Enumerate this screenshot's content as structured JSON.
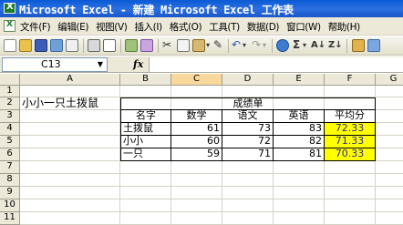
{
  "window": {
    "title": "Microsoft Excel - 新建 Microsoft Excel 工作表"
  },
  "menu": [
    "文件(F)",
    "编辑(E)",
    "视图(V)",
    "插入(I)",
    "格式(O)",
    "工具(T)",
    "数据(D)",
    "窗口(W)",
    "帮助(H)"
  ],
  "formula_bar": {
    "name_box": "C13",
    "fx_label": "fx",
    "value": ""
  },
  "columns": [
    "A",
    "B",
    "C",
    "D",
    "E",
    "F",
    "G"
  ],
  "rows": [
    "1",
    "2",
    "3",
    "4",
    "5",
    "6",
    "7",
    "8",
    "9",
    "10",
    "11"
  ],
  "sheet": {
    "a2": "小小一只土拨鼠",
    "table_title": "成绩单",
    "headers": [
      "名字",
      "数学",
      "语文",
      "英语",
      "平均分"
    ],
    "records": [
      {
        "name": "土拨鼠",
        "math": "61",
        "chinese": "73",
        "english": "83",
        "avg": "72.33"
      },
      {
        "name": "小小",
        "math": "60",
        "chinese": "72",
        "english": "82",
        "avg": "71.33"
      },
      {
        "name": "一只",
        "math": "59",
        "chinese": "71",
        "english": "81",
        "avg": "70.33"
      }
    ]
  },
  "colors": {
    "highlight": "#ffff00",
    "selected_header": "#f9d89c",
    "titlebar": "#2c6fe0"
  }
}
